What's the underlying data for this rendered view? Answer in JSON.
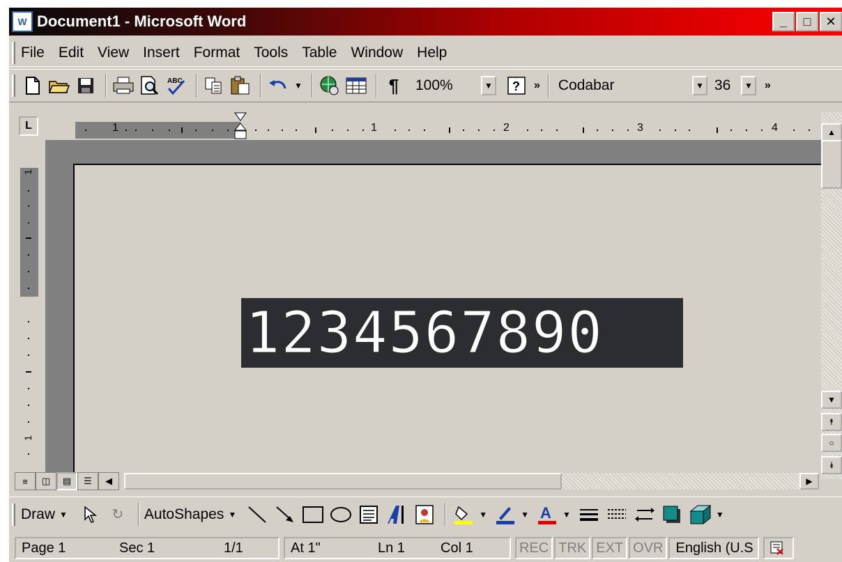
{
  "window": {
    "title": "Document1 - Microsoft Word",
    "icon_label": "W",
    "buttons": [
      "_",
      "□",
      "✕"
    ]
  },
  "menu": [
    "File",
    "Edit",
    "View",
    "Insert",
    "Format",
    "Tools",
    "Table",
    "Window",
    "Help"
  ],
  "toolbar": {
    "zoom": "100%",
    "font_name": "Codabar",
    "font_size": "36",
    "more_buttons": "»"
  },
  "ruler": {
    "tab_selector": "L",
    "labels": [
      "1",
      "1",
      "2",
      "3",
      "4"
    ]
  },
  "vertical_ruler": {
    "labels": [
      "1",
      "1"
    ]
  },
  "document": {
    "text": "1234567890"
  },
  "drawing_toolbar": {
    "draw_label": "Draw",
    "autoshapes_label": "AutoShapes"
  },
  "status": {
    "page": "Page  1",
    "sec": "Sec  1",
    "page_of": "1/1",
    "at": "At  1\"",
    "ln": "Ln  1",
    "col": "Col  1",
    "rec": "REC",
    "trk": "TRK",
    "ext": "EXT",
    "ovr": "OVR",
    "language": "English (U.S"
  },
  "colors": {
    "title_gradient_start": "#0a0a0a",
    "title_gradient_end": "#ff0000",
    "face": "#d4d0c8",
    "document_highlight": "#2b2d30"
  }
}
